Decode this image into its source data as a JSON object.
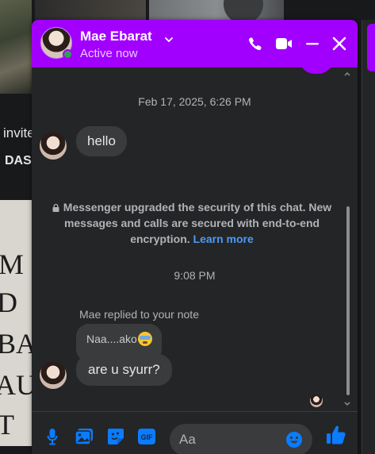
{
  "background": {
    "snippet_1": "invite",
    "snippet_2": "DAS",
    "card_letters": [
      "M",
      "D",
      "BA",
      "AU",
      "T"
    ]
  },
  "header": {
    "name": "Mae Ebarat",
    "status": "Active now",
    "color": "#a100ff"
  },
  "thread": {
    "timestamp_1": "Feb 17, 2025, 6:26 PM",
    "message_1": "hello",
    "notice_text": "Messenger upgraded the security of this chat. New messages and calls are secured with end-to-end encryption.",
    "notice_link": "Learn more",
    "timestamp_2": "9:08 PM",
    "reply_label": "Mae replied to your note",
    "note_text": "Naa....ako",
    "message_2": "are u syurr?"
  },
  "composer": {
    "placeholder": "Aa",
    "accent": "#0a7cff"
  },
  "icons": [
    "phone-icon",
    "video-icon",
    "minimize-icon",
    "close-icon",
    "microphone-icon",
    "image-icon",
    "sticker-icon",
    "gif-icon",
    "emoji-icon",
    "thumbs-up-icon",
    "lock-icon",
    "chevron-down-icon"
  ]
}
